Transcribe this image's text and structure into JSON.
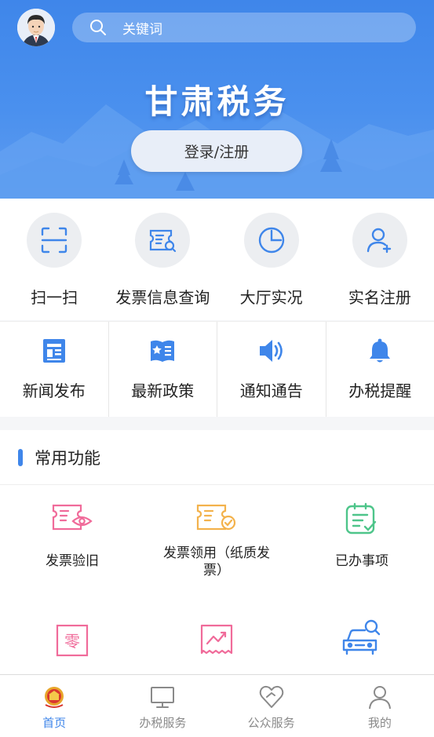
{
  "header": {
    "search_placeholder": "关键词",
    "brand_title": "甘肃税务",
    "login_label": "登录/注册",
    "accent": "#3f86ea"
  },
  "quick_row1": [
    {
      "label": "扫一扫",
      "icon": "scan-icon"
    },
    {
      "label": "发票信息查询",
      "icon": "invoice-search-icon"
    },
    {
      "label": "大厅实况",
      "icon": "clock-pie-icon"
    },
    {
      "label": "实名注册",
      "icon": "user-add-icon"
    }
  ],
  "quick_row2": [
    {
      "label": "新闻发布",
      "icon": "news-icon"
    },
    {
      "label": "最新政策",
      "icon": "policy-book-icon"
    },
    {
      "label": "通知通告",
      "icon": "speaker-icon"
    },
    {
      "label": "办税提醒",
      "icon": "bell-icon"
    }
  ],
  "common": {
    "title": "常用功能",
    "items": [
      {
        "label": "发票验旧",
        "icon": "invoice-eye-icon"
      },
      {
        "label": "发票领用（纸质发票）",
        "icon": "invoice-check-icon"
      },
      {
        "label": "已办事项",
        "icon": "clipboard-check-icon"
      },
      {
        "label": "",
        "icon": "zero-tax-icon"
      },
      {
        "label": "",
        "icon": "trend-receipt-icon"
      },
      {
        "label": "",
        "icon": "car-search-icon"
      }
    ]
  },
  "tabbar": [
    {
      "label": "首页",
      "icon": "emblem-icon",
      "active": true
    },
    {
      "label": "办税服务",
      "icon": "monitor-icon",
      "active": false
    },
    {
      "label": "公众服务",
      "icon": "heart-icon",
      "active": false
    },
    {
      "label": "我的",
      "icon": "user-icon",
      "active": false
    }
  ]
}
